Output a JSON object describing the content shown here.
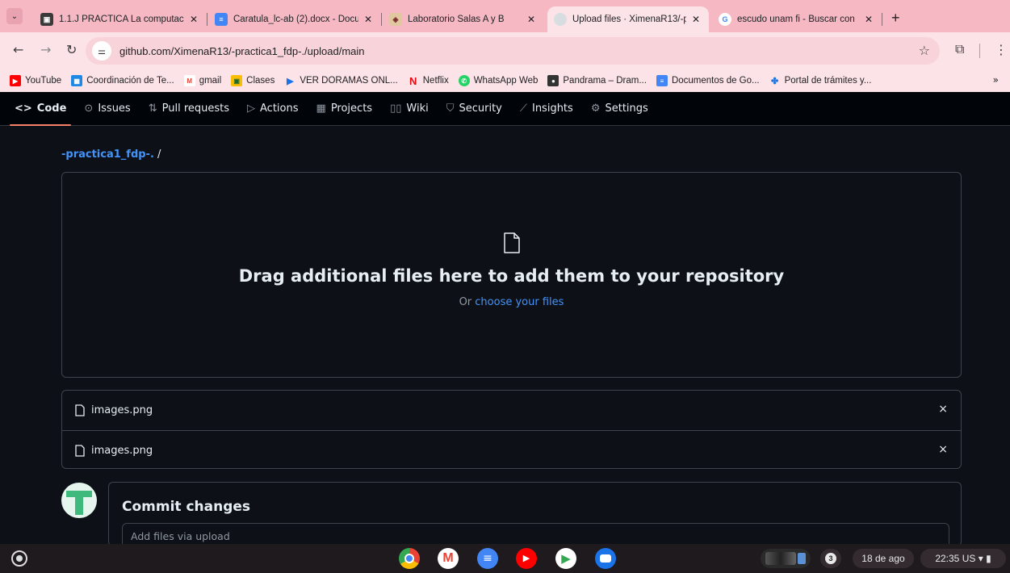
{
  "browser": {
    "tabs": [
      {
        "title": "1.1.J PRÁCTICA La computac",
        "favicon_color": "#3a3a3a"
      },
      {
        "title": "Caratula_lc-ab (2).docx - Docu",
        "favicon_color": "#4285f4"
      },
      {
        "title": "Laboratorio Salas A y B",
        "favicon_color": "#e0c7a0"
      },
      {
        "title": "Upload files · XimenaR13/-pr",
        "favicon_color": "#6e7681"
      },
      {
        "title": "escudo unam fi - Buscar con",
        "favicon_color": "#ffffff"
      }
    ],
    "active_tab_index": 3,
    "url": "github.com/XimenaR13/-practica1_fdp-./upload/main",
    "bookmarks": [
      {
        "label": "YouTube",
        "color": "#ff0000"
      },
      {
        "label": "Coordinación de Te...",
        "color": "#1e88e5"
      },
      {
        "label": "gmail",
        "color": "#ea4335"
      },
      {
        "label": "Clases",
        "color": "#fbbc04"
      },
      {
        "label": "VER DORAMAS ONL...",
        "color": "#1a73e8"
      },
      {
        "label": "Netflix",
        "color": "#e50914"
      },
      {
        "label": "WhatsApp Web",
        "color": "#25d366"
      },
      {
        "label": "Pandrama – Dram...",
        "color": "#333333"
      },
      {
        "label": "Documentos de Go...",
        "color": "#4285f4"
      },
      {
        "label": "Portal de trámites y...",
        "color": "#1a73e8"
      }
    ]
  },
  "repo_nav": {
    "tabs": [
      {
        "label": "Code",
        "icon": "code-icon",
        "glyph": "<>"
      },
      {
        "label": "Issues",
        "icon": "issues-icon",
        "glyph": "⊙"
      },
      {
        "label": "Pull requests",
        "icon": "pull-request-icon",
        "glyph": "⇅"
      },
      {
        "label": "Actions",
        "icon": "actions-icon",
        "glyph": "▷"
      },
      {
        "label": "Projects",
        "icon": "projects-icon",
        "glyph": "▦"
      },
      {
        "label": "Wiki",
        "icon": "wiki-icon",
        "glyph": "▯▯"
      },
      {
        "label": "Security",
        "icon": "shield-icon",
        "glyph": "⛉"
      },
      {
        "label": "Insights",
        "icon": "graph-icon",
        "glyph": "⟋"
      },
      {
        "label": "Settings",
        "icon": "gear-icon",
        "glyph": "⚙"
      }
    ],
    "active": "Code"
  },
  "upload": {
    "breadcrumb_repo": "-practica1_fdp-.",
    "breadcrumb_sep": " /",
    "drop_title": "Drag additional files here to add them to your repository",
    "drop_or": "Or ",
    "choose_link": "choose your files",
    "files": [
      "images.png",
      "images.png"
    ],
    "remove_glyph": "×"
  },
  "commit": {
    "title": "Commit changes",
    "placeholder": "Add files via upload"
  },
  "shelf": {
    "notification_count": "3",
    "date": "18 de ago",
    "time": "22:35",
    "locale": "US",
    "apps": [
      "chrome-icon",
      "gmail-icon",
      "docs-icon",
      "youtube-icon",
      "play-store-icon",
      "messages-icon"
    ]
  },
  "colors": {
    "accent": "#4493f8",
    "active_tab_underline": "#f78166",
    "chrome_pink": "#f6b9c4"
  }
}
